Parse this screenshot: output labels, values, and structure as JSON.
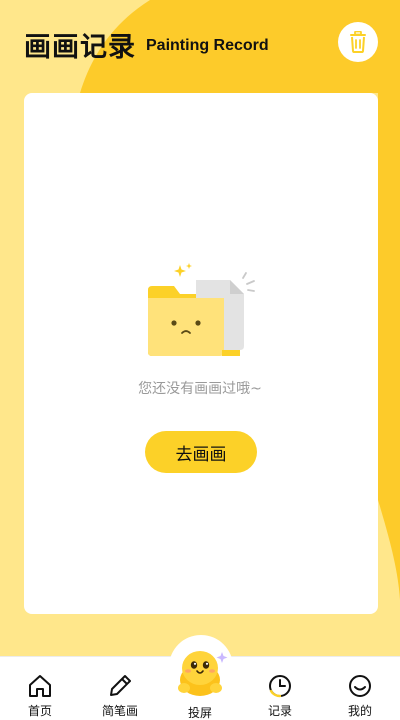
{
  "header": {
    "title_cn": "画画记录",
    "title_en": "Painting Record"
  },
  "empty_state": {
    "message": "您还没有画画过哦~",
    "button_label": "去画画"
  },
  "tabbar": {
    "items": [
      {
        "label": "首页",
        "icon": "home-icon"
      },
      {
        "label": "简笔画",
        "icon": "pencil-icon"
      },
      {
        "label": "投屏",
        "icon": "mascot-icon"
      },
      {
        "label": "记录",
        "icon": "clock-icon"
      },
      {
        "label": "我的",
        "icon": "smile-icon"
      }
    ]
  },
  "colors": {
    "accent": "#fcd128",
    "background_light": "#ffe78b",
    "background_swoosh": "#fdcb2a"
  }
}
